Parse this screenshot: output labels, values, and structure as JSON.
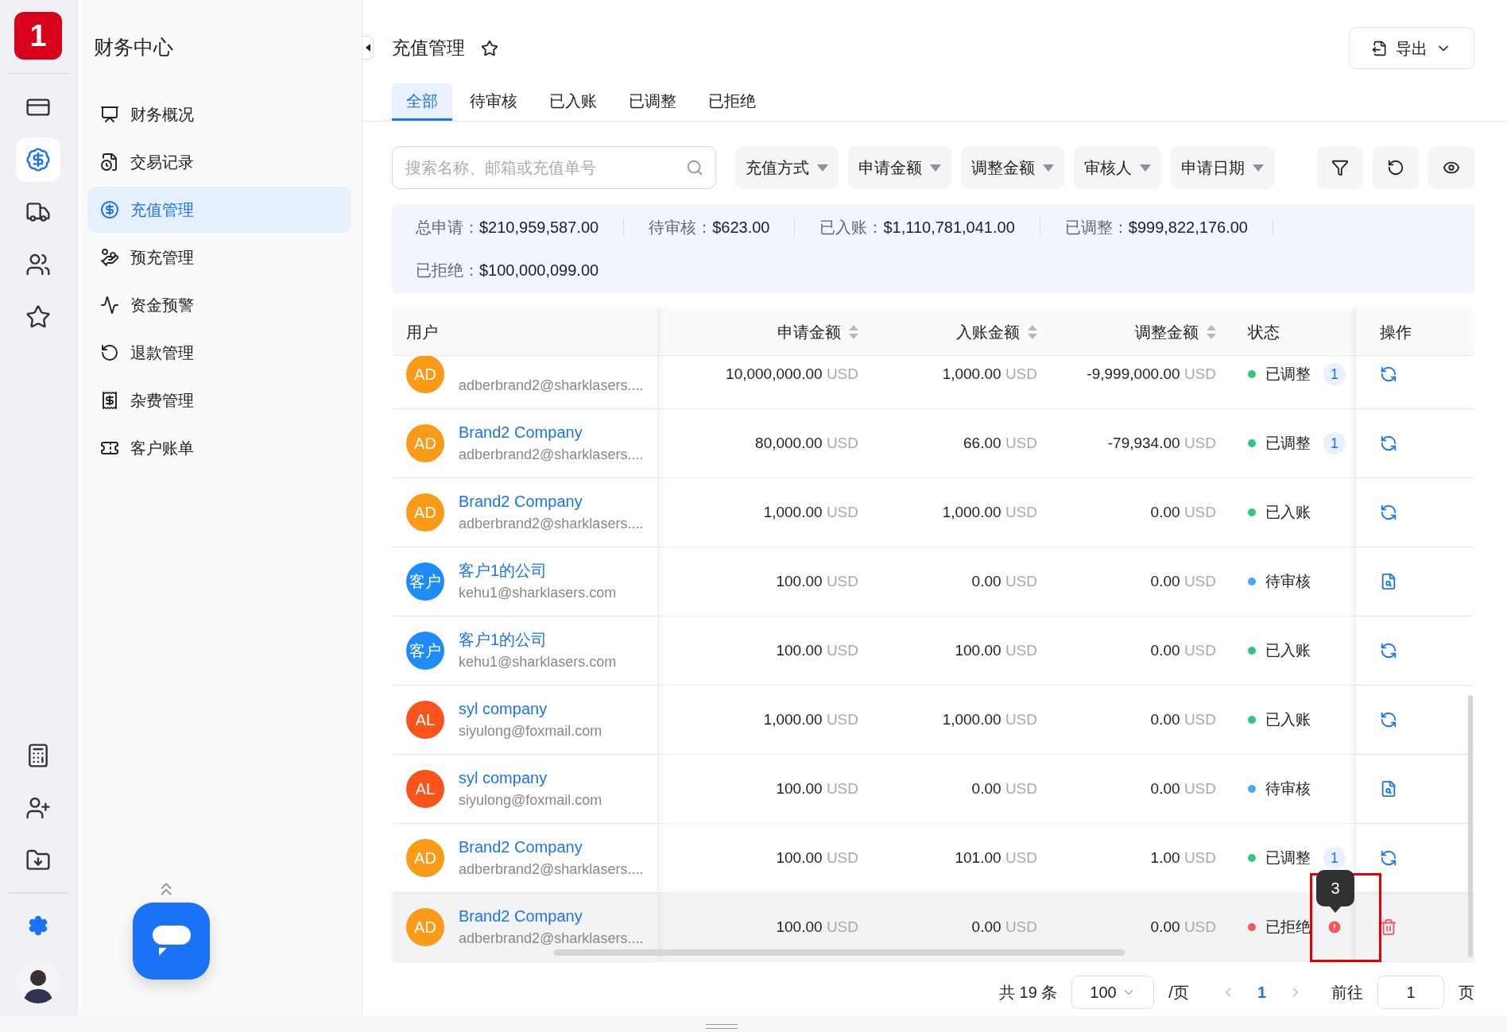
{
  "logo": {
    "text": "1"
  },
  "rail": {
    "top": [
      {
        "kind": "card",
        "selected": false
      },
      {
        "kind": "dollar",
        "selected": true
      },
      {
        "kind": "truck",
        "selected": false
      },
      {
        "kind": "users",
        "selected": false
      },
      {
        "kind": "star",
        "selected": false
      }
    ],
    "bottom": [
      {
        "kind": "calculator",
        "selected": false
      },
      {
        "kind": "user-plus",
        "selected": false
      },
      {
        "kind": "download",
        "selected": false
      },
      {
        "kind": "gear",
        "selected": true
      }
    ]
  },
  "sidebar": {
    "title": "财务中心",
    "items": [
      {
        "label": "财务概况",
        "selected": false
      },
      {
        "label": "交易记录",
        "selected": false
      },
      {
        "label": "充值管理",
        "selected": true
      },
      {
        "label": "预充管理",
        "selected": false
      },
      {
        "label": "资金预警",
        "selected": false
      },
      {
        "label": "退款管理",
        "selected": false
      },
      {
        "label": "杂费管理",
        "selected": false
      },
      {
        "label": "客户账单",
        "selected": false
      }
    ]
  },
  "page": {
    "title": "充值管理",
    "export": "导出"
  },
  "tabs": [
    {
      "label": "全部",
      "selected": true
    },
    {
      "label": "待审核",
      "selected": false
    },
    {
      "label": "已入账",
      "selected": false
    },
    {
      "label": "已调整",
      "selected": false
    },
    {
      "label": "已拒绝",
      "selected": false
    }
  ],
  "search": {
    "placeholder": "搜索名称、邮箱或充值单号"
  },
  "filters": [
    "充值方式",
    "申请金额",
    "调整金额",
    "审核人",
    "申请日期"
  ],
  "summary": [
    {
      "label": "总申请：",
      "value": "$210,959,587.00"
    },
    {
      "label": "待审核：",
      "value": "$623.00"
    },
    {
      "label": "已入账：",
      "value": "$1,110,781,041.00"
    },
    {
      "label": "已调整：",
      "value": "$999,822,176.00"
    },
    {
      "label": "已拒绝：",
      "value": "$100,000,099.00"
    }
  ],
  "table": {
    "columns": [
      {
        "label": "用户",
        "sortable": false
      },
      {
        "label": "申请金额",
        "sortable": true
      },
      {
        "label": "入账金额",
        "sortable": true
      },
      {
        "label": "调整金额",
        "sortable": true
      },
      {
        "label": "状态",
        "sortable": false
      },
      {
        "label": "操作",
        "sortable": false
      }
    ],
    "rows": [
      {
        "avatar": "AD",
        "color": "#fa9a17",
        "email": "adberbrand2@sharklasers....",
        "amounts": [
          {
            "value": "10,000,000.00",
            "unit": "USD"
          },
          {
            "value": "1,000.00",
            "unit": "USD"
          },
          {
            "value": "-9,999,000.00",
            "unit": "USD"
          }
        ],
        "status": {
          "label": "已调整",
          "color": "#34c77b",
          "count": "1"
        },
        "action": {
          "kind": "refund"
        },
        "hovered": false
      },
      {
        "avatar": "AD",
        "color": "#fa9a17",
        "name": "Brand2 Company",
        "email": "adberbrand2@sharklasers....",
        "amounts": [
          {
            "value": "80,000.00",
            "unit": "USD"
          },
          {
            "value": "66.00",
            "unit": "USD"
          },
          {
            "value": "-79,934.00",
            "unit": "USD"
          }
        ],
        "status": {
          "label": "已调整",
          "color": "#34c77b",
          "count": "1"
        },
        "action": {
          "kind": "refund"
        },
        "hovered": false
      },
      {
        "avatar": "AD",
        "color": "#fa9a17",
        "name": "Brand2 Company",
        "email": "adberbrand2@sharklasers....",
        "amounts": [
          {
            "value": "1,000.00",
            "unit": "USD"
          },
          {
            "value": "1,000.00",
            "unit": "USD"
          },
          {
            "value": "0.00",
            "unit": "USD"
          }
        ],
        "status": {
          "label": "已入账",
          "color": "#34c77b"
        },
        "action": {
          "kind": "refund"
        },
        "hovered": false
      },
      {
        "avatar": "客户",
        "color": "#1d8cf8",
        "name": "客户1的公司",
        "email": "kehu1@sharklasers.com",
        "amounts": [
          {
            "value": "100.00",
            "unit": "USD"
          },
          {
            "value": "0.00",
            "unit": "USD"
          },
          {
            "value": "0.00",
            "unit": "USD"
          }
        ],
        "status": {
          "label": "待审核",
          "color": "#4aa8f7"
        },
        "action": {
          "kind": "review"
        },
        "hovered": false
      },
      {
        "avatar": "客户",
        "color": "#1d8cf8",
        "name": "客户1的公司",
        "email": "kehu1@sharklasers.com",
        "amounts": [
          {
            "value": "100.00",
            "unit": "USD"
          },
          {
            "value": "100.00",
            "unit": "USD"
          },
          {
            "value": "0.00",
            "unit": "USD"
          }
        ],
        "status": {
          "label": "已入账",
          "color": "#34c77b"
        },
        "action": {
          "kind": "refund"
        },
        "hovered": false
      },
      {
        "avatar": "AL",
        "color": "#fa541c",
        "name": "syl company",
        "email": "siyulong@foxmail.com",
        "amounts": [
          {
            "value": "1,000.00",
            "unit": "USD"
          },
          {
            "value": "1,000.00",
            "unit": "USD"
          },
          {
            "value": "0.00",
            "unit": "USD"
          }
        ],
        "status": {
          "label": "已入账",
          "color": "#34c77b"
        },
        "action": {
          "kind": "refund"
        },
        "hovered": false
      },
      {
        "avatar": "AL",
        "color": "#fa541c",
        "name": "syl company",
        "email": "siyulong@foxmail.com",
        "amounts": [
          {
            "value": "100.00",
            "unit": "USD"
          },
          {
            "value": "0.00",
            "unit": "USD"
          },
          {
            "value": "0.00",
            "unit": "USD"
          }
        ],
        "status": {
          "label": "待审核",
          "color": "#4aa8f7"
        },
        "action": {
          "kind": "review"
        },
        "hovered": false
      },
      {
        "avatar": "AD",
        "color": "#fa9a17",
        "name": "Brand2 Company",
        "email": "adberbrand2@sharklasers....",
        "amounts": [
          {
            "value": "100.00",
            "unit": "USD"
          },
          {
            "value": "101.00",
            "unit": "USD"
          },
          {
            "value": "1.00",
            "unit": "USD"
          }
        ],
        "status": {
          "label": "已调整",
          "color": "#34c77b",
          "count": "1"
        },
        "action": {
          "kind": "refund"
        },
        "hovered": false
      },
      {
        "avatar": "AD",
        "color": "#fa9a17",
        "name": "Brand2 Company",
        "email": "adberbrand2@sharklasers....",
        "amounts": [
          {
            "value": "100.00",
            "unit": "USD"
          },
          {
            "value": "0.00",
            "unit": "USD"
          },
          {
            "value": "0.00",
            "unit": "USD"
          }
        ],
        "status": {
          "label": "已拒绝",
          "color": "#f5555d",
          "alert": true,
          "tooltip": "3",
          "framed": true
        },
        "action": {
          "kind": "delete"
        },
        "hovered": true
      }
    ]
  },
  "pagination": {
    "total": "共 19 条",
    "page_size": "100",
    "per_page": "/页",
    "pages": [
      {
        "label": "1",
        "selected": true
      }
    ],
    "goto": "前往",
    "goto_value": "1",
    "page_unit": "页"
  }
}
